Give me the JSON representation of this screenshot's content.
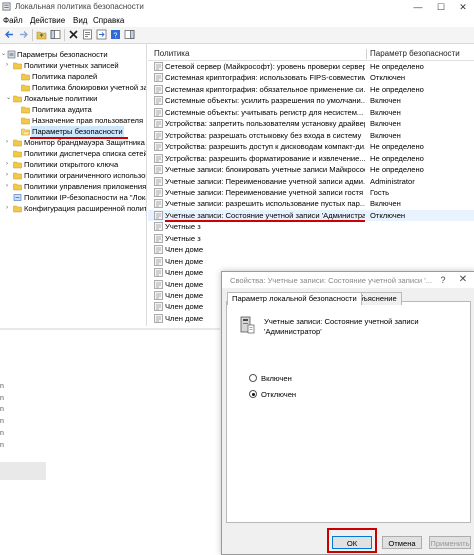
{
  "window": {
    "title": "Локальная политика безопасности",
    "minimize": "—",
    "maximize": "☐",
    "close": "✕"
  },
  "menu": [
    "Файл",
    "Действие",
    "Вид",
    "Справка"
  ],
  "tree": [
    {
      "label": "Параметры безопасности",
      "level": 0,
      "expander": "⌄",
      "icon": "security-settings-icon"
    },
    {
      "label": "Политики учетных записей",
      "level": 1,
      "expander": "›",
      "icon": "folder-icon"
    },
    {
      "label": "Политика паролей",
      "level": 2,
      "expander": "",
      "icon": "folder-icon"
    },
    {
      "label": "Политика блокировки учетной записи",
      "level": 2,
      "expander": "",
      "icon": "folder-icon"
    },
    {
      "label": "Локальные политики",
      "level": 1,
      "expander": "⌄",
      "icon": "folder-icon"
    },
    {
      "label": "Политика аудита",
      "level": 2,
      "expander": "",
      "icon": "folder-icon"
    },
    {
      "label": "Назначение прав пользователя",
      "level": 2,
      "expander": "",
      "icon": "folder-icon"
    },
    {
      "label": "Параметры безопасности",
      "level": 2,
      "expander": "",
      "icon": "folder-open-icon",
      "selected": true
    },
    {
      "label": "Монитор брандмауэра Защитника Windows",
      "level": 1,
      "expander": "›",
      "icon": "folder-icon"
    },
    {
      "label": "Политики диспетчера списка сетей",
      "level": 1,
      "expander": "",
      "icon": "folder-icon"
    },
    {
      "label": "Политики открытого ключа",
      "level": 1,
      "expander": "›",
      "icon": "folder-icon"
    },
    {
      "label": "Политики ограниченного использования",
      "level": 1,
      "expander": "›",
      "icon": "folder-icon"
    },
    {
      "label": "Политики управления приложениями",
      "level": 1,
      "expander": "›",
      "icon": "folder-icon"
    },
    {
      "label": "Политики IP-безопасности на \"Лока",
      "level": 1,
      "expander": "",
      "icon": "ipsec-icon"
    },
    {
      "label": "Конфигурация расширенной политики",
      "level": 1,
      "expander": "›",
      "icon": "folder-icon"
    }
  ],
  "list": {
    "col_policy": "Политика",
    "col_value": "Параметр безопасности",
    "rows": [
      {
        "policy": "Сетевой сервер (Майкрософт): уровень проверки сервером...",
        "value": "Не определено"
      },
      {
        "policy": "Системная криптография: использовать FIPS-совместим...",
        "value": "Отключен"
      },
      {
        "policy": "Системная криптография: обязательное применение си...",
        "value": "Не определено"
      },
      {
        "policy": "Системные объекты: усилить разрешения по умолчани...",
        "value": "Включен"
      },
      {
        "policy": "Системные объекты: учитывать регистр для несистем...",
        "value": "Включен"
      },
      {
        "policy": "Устройства: запретить пользователям установку драйвер...",
        "value": "Включен"
      },
      {
        "policy": "Устройства: разрешать отстыковку без входа в систему",
        "value": "Включен"
      },
      {
        "policy": "Устройства: разрешить доступ к дисководам компакт-ди...",
        "value": "Не определено"
      },
      {
        "policy": "Устройства: разрешить форматирование и извлечение...",
        "value": "Не определено"
      },
      {
        "policy": "Учетные записи: блокировать учетные записи Майкрософ...",
        "value": "Не определено"
      },
      {
        "policy": "Учетные записи: Переименование учетной записи адми...",
        "value": "Administrator"
      },
      {
        "policy": "Учетные записи: Переименование учетной записи гостя",
        "value": "Гость"
      },
      {
        "policy": "Учетные записи: разрешить использование пустых пар...",
        "value": "Включен"
      },
      {
        "policy": "Учетные записи: Состояние учетной записи 'Администрат...",
        "value": "Отключен",
        "highlight": true
      },
      {
        "policy": "Учетные з",
        "value": ""
      },
      {
        "policy": "Учетные з",
        "value": ""
      },
      {
        "policy": "Член доме",
        "value": ""
      },
      {
        "policy": "Член доме",
        "value": ""
      },
      {
        "policy": "Член доме",
        "value": ""
      },
      {
        "policy": "Член доме",
        "value": ""
      },
      {
        "policy": "Член доме",
        "value": ""
      },
      {
        "policy": "Член доме",
        "value": ""
      },
      {
        "policy": "Член доме",
        "value": ""
      }
    ]
  },
  "dialog": {
    "title": "Свойства: Учетные записи: Состояние учетной записи '...",
    "help": "?",
    "close": "✕",
    "tabs": [
      "Параметр локальной безопасности",
      "Объяснение"
    ],
    "policy_name": "Учетные записи: Состояние учетной записи 'Администратор'",
    "options": [
      {
        "label": "Включен",
        "checked": false
      },
      {
        "label": "Отключен",
        "checked": true
      }
    ],
    "ok": "ОК",
    "cancel": "Отмена",
    "apply": "Применить"
  },
  "left_pane_ticks": [
    "n",
    "n",
    "n",
    "n",
    "n",
    "n",
    "r"
  ],
  "colors": {
    "annotation": "#d10000",
    "selection": "#cce8ff",
    "accent": "#0078d7"
  }
}
